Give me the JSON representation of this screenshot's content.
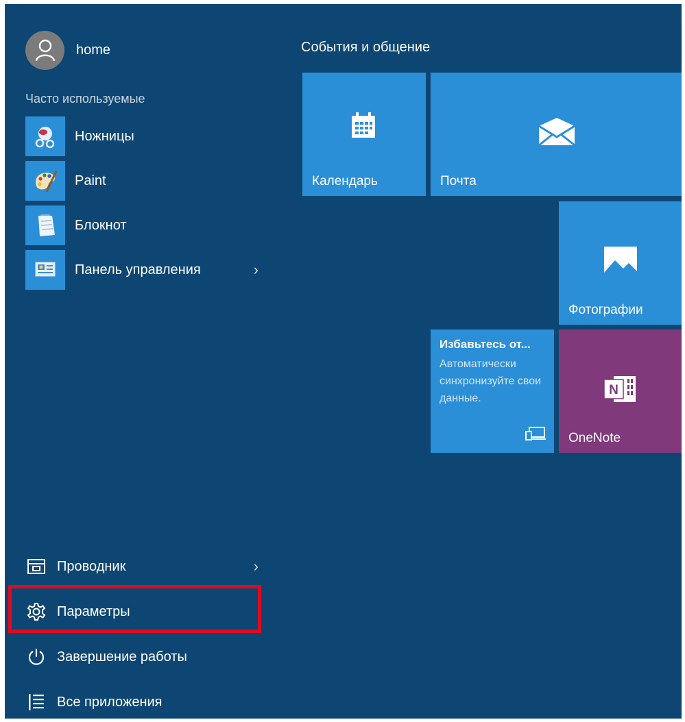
{
  "user": {
    "name": "home",
    "avatar_icon": "person-icon"
  },
  "frequent": {
    "label": "Часто используемые",
    "items": [
      {
        "label": "Ножницы",
        "icon": "scissors-icon"
      },
      {
        "label": "Paint",
        "icon": "paint-palette-icon"
      },
      {
        "label": "Блокнот",
        "icon": "notepad-icon"
      },
      {
        "label": "Панель управления",
        "icon": "control-panel-icon",
        "has_submenu": true
      }
    ]
  },
  "bottom": {
    "items": [
      {
        "label": "Проводник",
        "icon": "file-explorer-icon",
        "has_submenu": true
      },
      {
        "label": "Параметры",
        "icon": "gear-icon",
        "highlighted": true
      },
      {
        "label": "Завершение работы",
        "icon": "power-icon"
      },
      {
        "label": "Все приложения",
        "icon": "all-apps-list-icon"
      }
    ]
  },
  "tiles": {
    "group_title": "События и общение",
    "calendar": {
      "label": "Календарь",
      "icon": "calendar-icon"
    },
    "mail": {
      "label": "Почта",
      "icon": "mail-envelope-icon"
    },
    "photos": {
      "label": "Фотографии",
      "icon": "photo-icon"
    },
    "promo": {
      "title": "Избавьтесь от...",
      "body": "Автоматически синхронизуйте свои данные.",
      "icon": "devices-icon"
    },
    "onenote": {
      "label": "OneNote",
      "icon": "onenote-icon"
    }
  },
  "colors": {
    "menu_background": "#0d4672",
    "tile_blue": "#2b8fd8",
    "tile_purple": "#80397b",
    "highlight_red": "#e3081e"
  }
}
